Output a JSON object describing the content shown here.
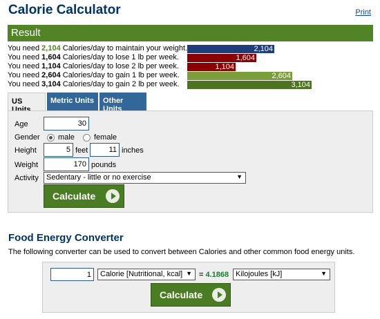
{
  "title": "Calorie Calculator",
  "print_label": "Print",
  "result": {
    "heading": "Result",
    "lines": [
      {
        "pre": "You need ",
        "value": "2,104",
        "post": " Calories/day to maintain your weight.",
        "bar_label": "2,104",
        "color": "#1f3d7a"
      },
      {
        "pre": "You need ",
        "value": "1,604",
        "post": " Calories/day to lose 1 lb per week.",
        "bar_label": "1,604",
        "color": "#8b0000"
      },
      {
        "pre": "You need ",
        "value": "1,104",
        "post": " Calories/day to lose 2 lb per week.",
        "bar_label": "1,104",
        "color": "#8b0000"
      },
      {
        "pre": "You need ",
        "value": "2,604",
        "post": " Calories/day to gain 1 lb per week.",
        "bar_label": "2,604",
        "color": "#7a9e3a"
      },
      {
        "pre": "You need ",
        "value": "3,104",
        "post": " Calories/day to gain 2 lb per week.",
        "bar_label": "3,104",
        "color": "#4d7320"
      }
    ]
  },
  "tabs": [
    "US Units",
    "Metric Units",
    "Other Units"
  ],
  "form": {
    "age_label": "Age",
    "age_value": "30",
    "gender_label": "Gender",
    "male_label": "male",
    "female_label": "female",
    "height_label": "Height",
    "feet_value": "5",
    "feet_label": "feet",
    "inches_value": "11",
    "inches_label": "inches",
    "weight_label": "Weight",
    "weight_value": "170",
    "weight_unit": "pounds",
    "activity_label": "Activity",
    "activity_value": "Sedentary - little or no exercise",
    "calculate_label": "Calculate"
  },
  "converter": {
    "title": "Food Energy Converter",
    "description": "The following converter can be used to convert between Calories and other common food energy units.",
    "input_value": "1",
    "from_unit": "Calorie [Nutritional, kcal]",
    "equals": "=",
    "result": "4.1868",
    "to_unit": "Kilojoules [kJ]",
    "calculate_label": "Calculate"
  }
}
